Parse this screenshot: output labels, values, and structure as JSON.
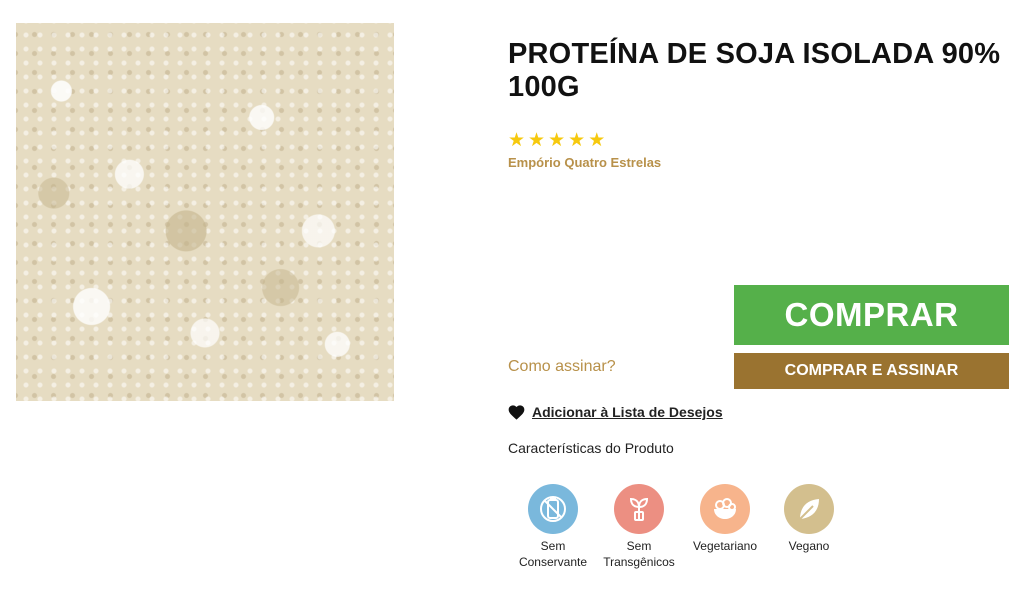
{
  "product": {
    "title": "PROTEÍNA DE SOJA ISOLADA 90% 100G",
    "rating_stars": 5,
    "brand": "Empório Quatro Estrelas"
  },
  "actions": {
    "buy_label": "COMPRAR",
    "buy_subscribe_label": "COMPRAR E ASSINAR",
    "how_subscribe_label": "Como assinar?",
    "wishlist_label": "Adicionar à Lista de Desejos"
  },
  "features": {
    "heading": "Características do Produto",
    "items": [
      {
        "label": "Sem Conservante",
        "icon": "no-preservative-icon",
        "color": "#7ab8dc"
      },
      {
        "label": "Sem Transgênicos",
        "icon": "no-gmo-sprout-icon",
        "color": "#ec8f82"
      },
      {
        "label": "Vegetariano",
        "icon": "vegetarian-bowl-icon",
        "color": "#f7b48c"
      },
      {
        "label": "Vegano",
        "icon": "vegan-leaf-icon",
        "color": "#d3bf8e"
      }
    ]
  },
  "colors": {
    "buy_button": "#55b04a",
    "subscribe_button": "#9a7330",
    "accent_gold": "#b8914a",
    "star": "#f6c90e"
  }
}
